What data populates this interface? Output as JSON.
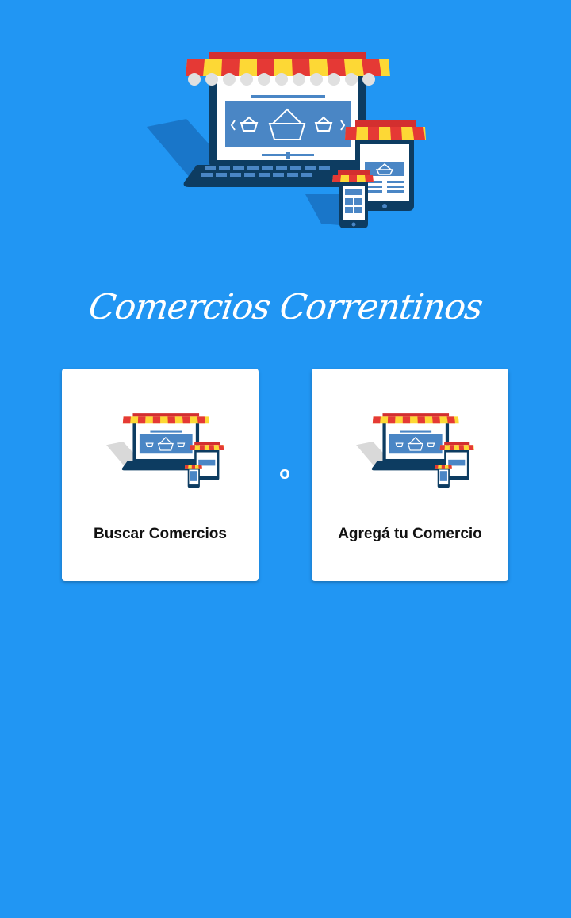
{
  "app": {
    "title": "Comercios Correntinos"
  },
  "hero": {
    "icon": "online-shop-illustration-icon"
  },
  "cards": {
    "search": {
      "label": "Buscar Comercios",
      "icon": "online-shop-icon"
    },
    "add": {
      "label": "Agregá tu Comercio",
      "icon": "online-shop-icon"
    }
  },
  "separator": "o",
  "colors": {
    "background": "#2196F3",
    "card": "#FFFFFF",
    "awning_red": "#E53935",
    "awning_yellow": "#FDD835",
    "device_dark": "#0D3C61",
    "screen_blue": "#4A86C5"
  }
}
